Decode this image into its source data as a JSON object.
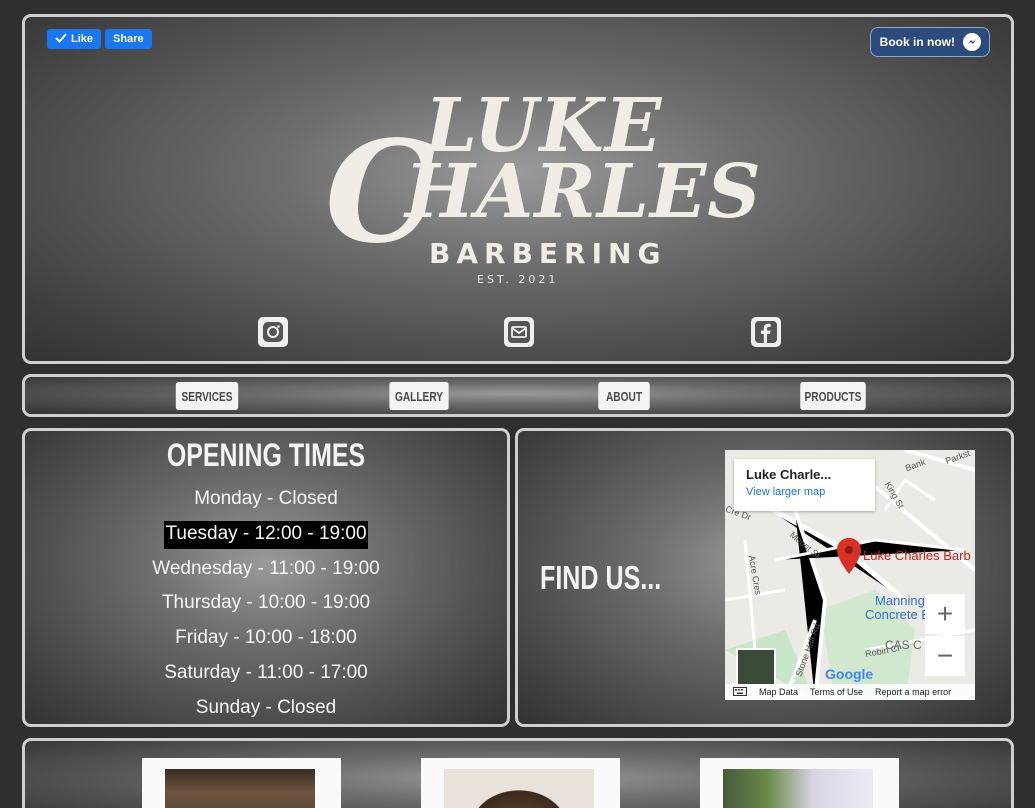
{
  "header": {
    "facebook": {
      "like_label": "Like",
      "share_label": "Share"
    },
    "book_button_label": "Book in now!",
    "logo": {
      "line1": "LUKE",
      "line2_initial": "C",
      "line2_rest": "HARLES",
      "tagline": "BARBERING",
      "est": "EST. 2021"
    },
    "social_icons": [
      "instagram-icon",
      "envelope-icon",
      "facebook-icon"
    ]
  },
  "nav": {
    "items": [
      {
        "label": "SERVICES"
      },
      {
        "label": "GALLERY"
      },
      {
        "label": "ABOUT"
      },
      {
        "label": "PRODUCTS"
      }
    ]
  },
  "opening_times": {
    "title": "OPENING TIMES",
    "days": [
      "Monday - Closed",
      "Tuesday - 12:00 - 19:00",
      "Wednesday - 11:00 - 19:00",
      "Thursday - 10:00 - 19:00",
      "Friday - 10:00 - 18:00",
      "Saturday - 11:00 - 17:00",
      "Sunday - Closed"
    ],
    "highlighted_index": 1
  },
  "find_us": {
    "title": "FIND US...",
    "map": {
      "place_name": "Luke Charle...",
      "view_larger": "View larger map",
      "marker_label": "Luke Charles Barb",
      "zoom_in": "+",
      "zoom_out": "−",
      "footer": {
        "map_data": "Map Data",
        "terms": "Terms of Use",
        "report": "Report a map error"
      },
      "google_logo": "Google",
      "street_labels": [
        "Bank",
        "Parkst",
        "King St",
        "Mount St",
        "Acre Cres",
        "Stone Hall Rd",
        "Robin Cl",
        "Manning",
        "Concrete Eccle",
        "CAS C",
        "Cre Dr"
      ]
    }
  },
  "colors": {
    "panel_border": "#cfcfcf",
    "facebook_blue": "#1877f2",
    "book_button": "#2d4a7c",
    "map_pin": "#d93025"
  }
}
